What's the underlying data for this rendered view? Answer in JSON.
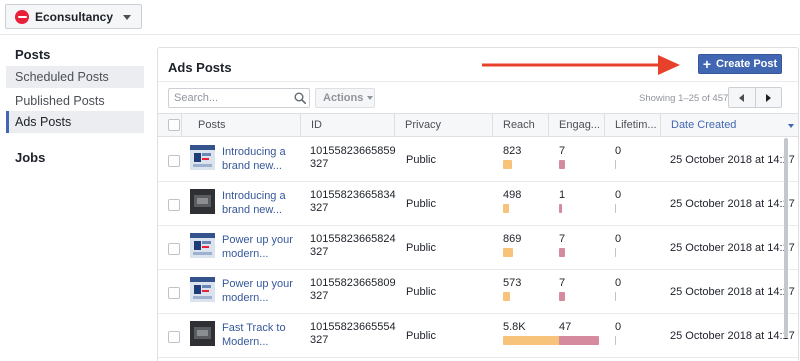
{
  "page_selector": {
    "name": "Econsultancy"
  },
  "sidebar": {
    "posts_heading": "Posts",
    "items": [
      {
        "label": "Scheduled Posts"
      },
      {
        "label": "Published Posts"
      },
      {
        "label": "Ads Posts"
      }
    ],
    "jobs_heading": "Jobs"
  },
  "panel": {
    "title": "Ads Posts",
    "create_button": "Create Post",
    "search_placeholder": "Search...",
    "actions_label": "Actions",
    "showing": "Showing 1–25 of 457"
  },
  "table": {
    "columns": [
      "Posts",
      "ID",
      "Privacy",
      "Reach",
      "Engag...",
      "Lifetim...",
      "Date Created"
    ],
    "rows": [
      {
        "title": "Introducing a brand new...",
        "id": "10155823665859 327",
        "privacy": "Public",
        "reach": "823",
        "reach_fraction": 0.14,
        "engagement": "7",
        "eng_fraction": 0.15,
        "lifetime": "0",
        "date": "25 October 2018 at 14:17",
        "thumb": "light"
      },
      {
        "title": "Introducing a brand new...",
        "id": "10155823665834 327",
        "privacy": "Public",
        "reach": "498",
        "reach_fraction": 0.09,
        "engagement": "1",
        "eng_fraction": 0.02,
        "lifetime": "0",
        "date": "25 October 2018 at 14:17",
        "thumb": "dark"
      },
      {
        "title": "Power up your modern...",
        "id": "10155823665824 327",
        "privacy": "Public",
        "reach": "869",
        "reach_fraction": 0.15,
        "engagement": "7",
        "eng_fraction": 0.15,
        "lifetime": "0",
        "date": "25 October 2018 at 14:17",
        "thumb": "light"
      },
      {
        "title": "Power up your modern...",
        "id": "10155823665809 327",
        "privacy": "Public",
        "reach": "573",
        "reach_fraction": 0.1,
        "engagement": "7",
        "eng_fraction": 0.15,
        "lifetime": "0",
        "date": "25 October 2018 at 14:17",
        "thumb": "light"
      },
      {
        "title": "Fast Track to Modern...",
        "id": "10155823665554 327",
        "privacy": "Public",
        "reach": "5.8K",
        "reach_fraction": 1.0,
        "engagement": "47",
        "eng_fraction": 1.0,
        "lifetime": "0",
        "date": "25 October 2018 at 14:17",
        "thumb": "dark"
      }
    ]
  },
  "colors": {
    "accent": "#4267b2",
    "reach_bar": "#f7c37a",
    "engagement_bar": "#d58a9d",
    "arrow": "#e8412b"
  }
}
